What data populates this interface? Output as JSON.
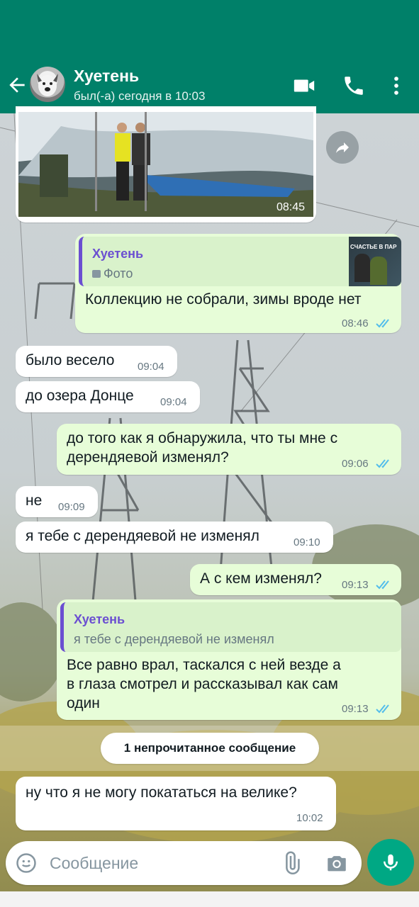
{
  "header": {
    "contact_name": "Хуетень",
    "status": "был(-а) сегодня в 10:03",
    "icons": [
      "back-arrow-icon",
      "video-call-icon",
      "voice-call-icon",
      "more-options-icon"
    ]
  },
  "messages": [
    {
      "id": "photo",
      "type": "image",
      "direction": "in",
      "time": "08:45"
    },
    {
      "id": "m1",
      "direction": "out",
      "quote_name": "Хуетень",
      "quote_text": "Фото",
      "quote_thumb_text": "СЧАСТЬЕ В ПАР",
      "text": "Коллекцию не собрали, зимы вроде нет",
      "time": "08:46",
      "read": true
    },
    {
      "id": "m2",
      "direction": "in",
      "text": "было весело",
      "time": "09:04"
    },
    {
      "id": "m3",
      "direction": "in",
      "text": "до озера Донце",
      "time": "09:04"
    },
    {
      "id": "m4",
      "direction": "out",
      "text_line1": "до того как я обнаружила, что ты мне с",
      "text_line2": "дерендяевой изменял?",
      "time": "09:06",
      "read": true
    },
    {
      "id": "m5",
      "direction": "in",
      "text": "не",
      "time": "09:09"
    },
    {
      "id": "m6",
      "direction": "in",
      "text": "я тебе с дерендяевой не изменял",
      "time": "09:10"
    },
    {
      "id": "m7",
      "direction": "out",
      "text": "А с кем изменял?",
      "time": "09:13",
      "read": true
    },
    {
      "id": "m8",
      "direction": "out",
      "quote_name": "Хуетень",
      "quote_text": "я тебе с дерендяевой не изменял",
      "text_line1": "Все равно врал, таскался с ней везде а",
      "text_line2": "в глаза смотрел и рассказывал как сам",
      "text_line3": "один",
      "time": "09:13",
      "read": true
    },
    {
      "id": "m9",
      "direction": "in",
      "text": "ну что я не могу покататься на велике?",
      "time": "10:02"
    }
  ],
  "unread_label": "1 непрочитанное сообщение",
  "composer": {
    "placeholder": "Сообщение",
    "icons": [
      "emoji-icon",
      "attach-icon",
      "camera-icon",
      "microphone-icon"
    ]
  },
  "colors": {
    "header": "#008069",
    "outgoing": "#e7fdd8",
    "incoming": "#ffffff",
    "accent": "#00a884",
    "read_ticks": "#53bdeb",
    "quote_name": "#6b4fd1"
  }
}
